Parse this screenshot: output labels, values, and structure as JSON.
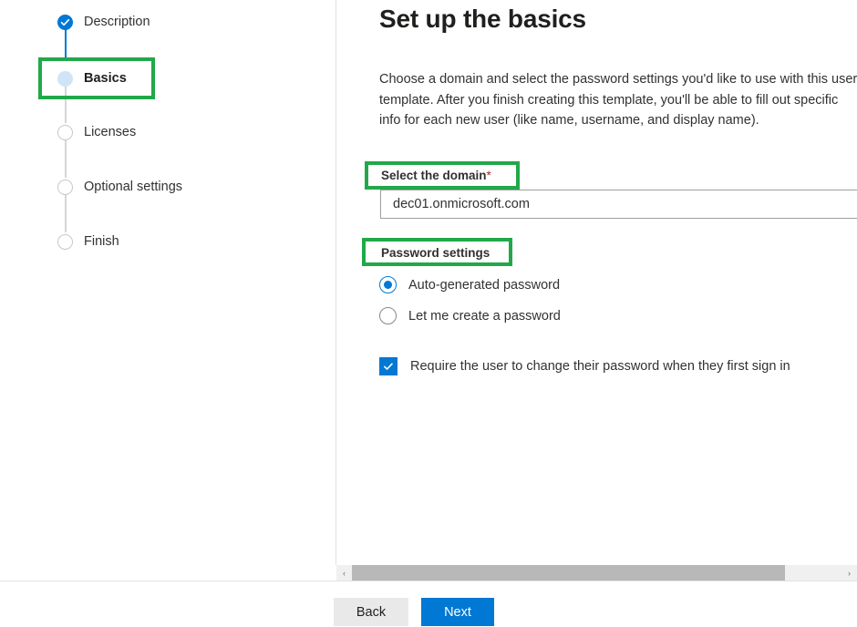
{
  "wizard": {
    "steps": [
      {
        "label": "Description",
        "state": "completed",
        "icon": "check-circle-icon"
      },
      {
        "label": "Basics",
        "state": "current",
        "icon": "current-step-icon",
        "highlighted": true
      },
      {
        "label": "Licenses",
        "state": "todo",
        "icon": "empty-circle-icon"
      },
      {
        "label": "Optional settings",
        "state": "todo",
        "icon": "empty-circle-icon"
      },
      {
        "label": "Finish",
        "state": "todo",
        "icon": "empty-circle-icon"
      }
    ]
  },
  "main": {
    "title": "Set up the basics",
    "intro": "Choose a domain and select the password settings you'd like to use with this user template. After you finish creating this template, you'll be able to fill out specific info for each new user (like name, username, and display name).",
    "domain": {
      "label": "Select the domain",
      "required_marker": "*",
      "value": "dec01.onmicrosoft.com",
      "placeholder": ""
    },
    "password_settings": {
      "label": "Password settings",
      "options": [
        {
          "label": "Auto-generated password",
          "selected": true
        },
        {
          "label": "Let me create a password",
          "selected": false
        }
      ],
      "require_change": {
        "label": "Require the user to change their password when they first sign in",
        "checked": true
      }
    }
  },
  "scrollbar": {
    "left_arrow": "‹",
    "right_arrow": "›"
  },
  "footer": {
    "back_label": "Back",
    "next_label": "Next"
  },
  "colors": {
    "accent": "#0078d4",
    "highlight_green": "#22a84a",
    "required_red": "#a4262c",
    "text": "#323130",
    "current_step_fill": "#cfe4f7"
  }
}
